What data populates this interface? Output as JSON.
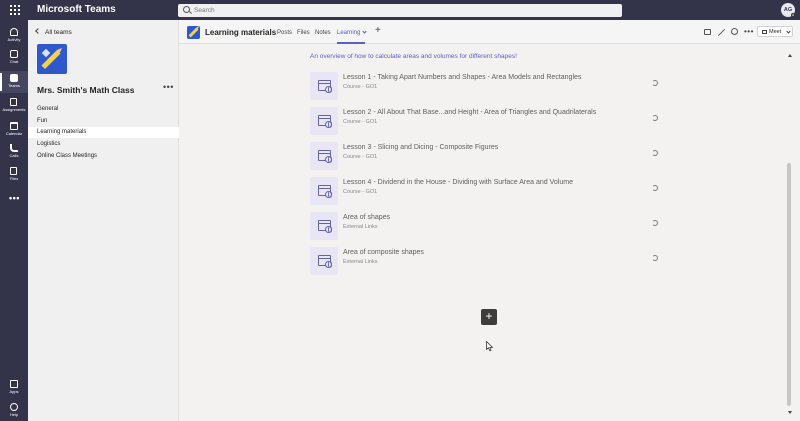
{
  "topbar": {
    "app_title": "Microsoft Teams",
    "search_placeholder": "Search",
    "avatar_initials": "AG"
  },
  "rail": {
    "items": [
      {
        "label": "Activity",
        "icon": "bell-icon",
        "active": false
      },
      {
        "label": "Chat",
        "icon": "chat-icon",
        "active": false
      },
      {
        "label": "Teams",
        "icon": "teams-icon",
        "active": true
      },
      {
        "label": "Assignments",
        "icon": "assignments-icon",
        "active": false
      },
      {
        "label": "Calendar",
        "icon": "calendar-icon",
        "active": false
      },
      {
        "label": "Calls",
        "icon": "phone-icon",
        "active": false
      },
      {
        "label": "Files",
        "icon": "file-icon",
        "active": false
      }
    ],
    "more_label": "•••",
    "bottom": [
      {
        "label": "Apps",
        "icon": "apps-icon"
      },
      {
        "label": "Help",
        "icon": "help-icon"
      }
    ]
  },
  "left_panel": {
    "back_label": "All teams",
    "team_name": "Mrs. Smith's Math Class",
    "more_label": "•••",
    "channels": [
      {
        "label": "General",
        "active": false
      },
      {
        "label": "Fun",
        "active": false
      },
      {
        "label": "Learning materials",
        "active": true
      },
      {
        "label": "Logistics",
        "active": false
      },
      {
        "label": "Online Class Meetings",
        "active": false
      }
    ]
  },
  "header": {
    "channel_name": "Learning materials",
    "tabs": [
      "Posts",
      "Files",
      "Notes",
      "Learning"
    ],
    "active_tab": "Learning",
    "add_tab_label": "+",
    "more_label": "•••",
    "meet_label": "Meet"
  },
  "content": {
    "overview": "An overview of how to calculate areas and volumes for different shapes!",
    "items": [
      {
        "title": "Lesson 1 - Taking Apart Numbers and Shapes - Area Models and Rectangles",
        "subtitle": "Course - GO1"
      },
      {
        "title": "Lesson 2 - All About That Base...and Height - Area of Triangles and Quadrilaterals",
        "subtitle": "Course - GO1"
      },
      {
        "title": "Lesson 3 - Slicing and Dicing - Composite Figures",
        "subtitle": "Course - GO1"
      },
      {
        "title": "Lesson 4 - Dividend in the House - Dividing with Surface Area and Volume",
        "subtitle": "Course - GO1"
      },
      {
        "title": "Area of shapes",
        "subtitle": "External Links"
      },
      {
        "title": "Area of composite shapes",
        "subtitle": "External Links"
      }
    ],
    "add_button_label": "+"
  },
  "colors": {
    "topbar": "#33344a",
    "accent": "#5b5fc7",
    "brand_logo": "#2f58cd"
  }
}
